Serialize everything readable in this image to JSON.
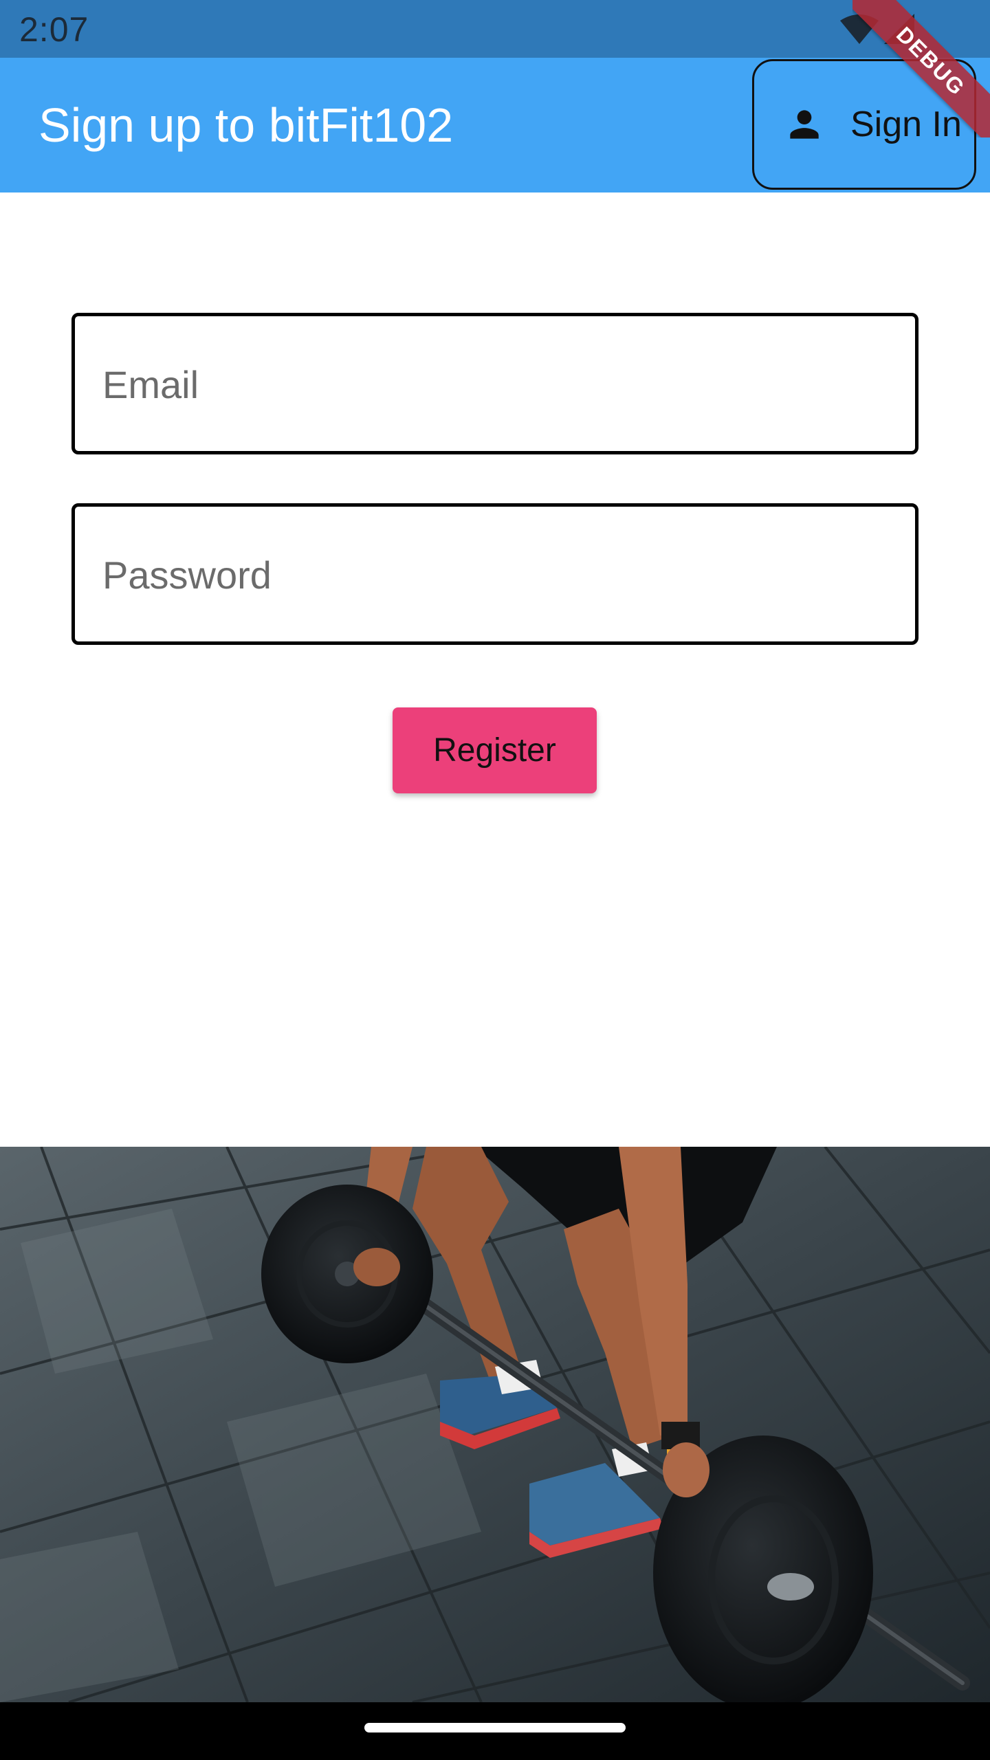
{
  "status_bar": {
    "time": "2:07",
    "icons": [
      "wifi-icon",
      "cell-signal-icon"
    ]
  },
  "debug_banner": {
    "label": "DEBUG"
  },
  "app_bar": {
    "title": "Sign up to bitFit102",
    "sign_in_button": {
      "label": "Sign In",
      "icon": "person-icon"
    },
    "color": "#42a5f5"
  },
  "form": {
    "email": {
      "placeholder": "Email",
      "value": ""
    },
    "password": {
      "placeholder": "Password",
      "value": ""
    },
    "register_button": {
      "label": "Register",
      "color": "#ec407a"
    }
  },
  "hero_image": {
    "subject": "weightlifter-deadlift-photo"
  }
}
